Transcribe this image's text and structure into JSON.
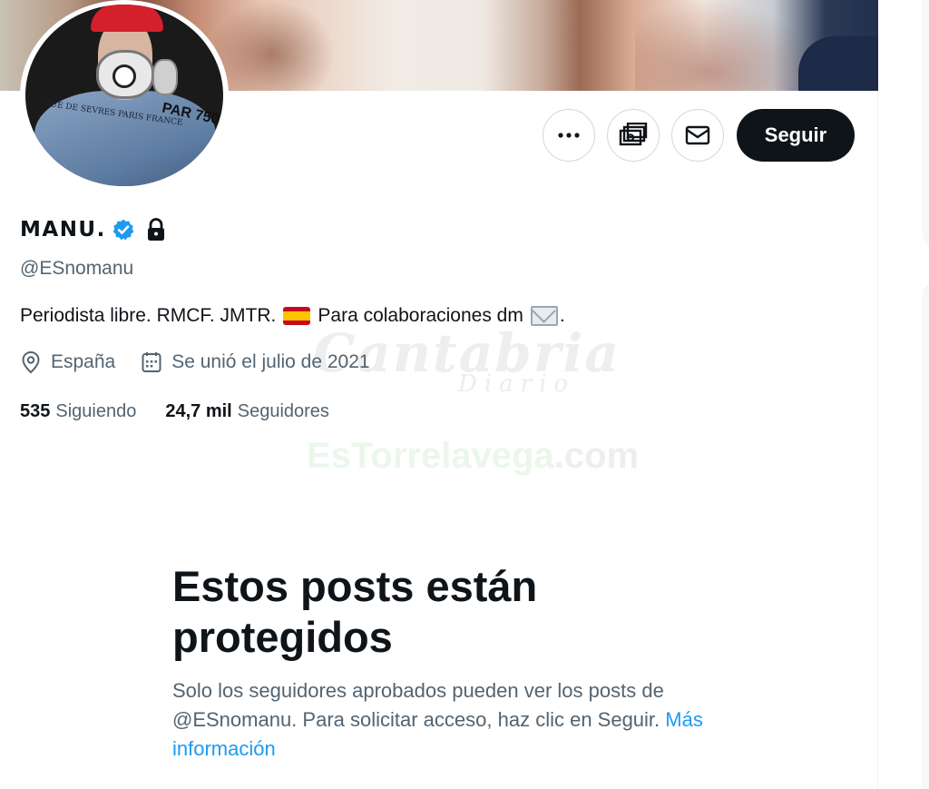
{
  "profile": {
    "name": "MANU.",
    "handle": "@ESnomanu",
    "bio": "Periodista libre. RMCF. JMTR.",
    "bio_after_flag": "Para colaboraciones dm",
    "bio_end": ".",
    "location": "España",
    "joined": "Se unió el julio de 2021",
    "following_count": "535",
    "following_label": "Siguiendo",
    "followers_count": "24,7 mil",
    "followers_label": "Seguidores",
    "verified": true,
    "protected": true
  },
  "avatar": {
    "jacket_text_left": "RUE DE SEVRES PARIS FRANCE",
    "jacket_text_right": "PAR 750"
  },
  "actions": {
    "more_icon": "more-icon",
    "tip_icon": "money-icon",
    "message_icon": "envelope-icon",
    "follow_label": "Seguir"
  },
  "protected_notice": {
    "title": "Estos posts están protegidos",
    "text": "Solo los seguidores aprobados pueden ver los posts de @ESnomanu. Para solicitar acceso, haz clic en Seguir.",
    "link": "Más información"
  },
  "watermarks": {
    "brand1": "Cantabria",
    "brand1_sub": "Diario",
    "brand2_green": "EsTorrelavega",
    "brand2_gray": ".com"
  },
  "colors": {
    "accent": "#1d9bf0",
    "text": "#0f1419",
    "muted": "#536471",
    "follow_bg": "#0f1419"
  }
}
